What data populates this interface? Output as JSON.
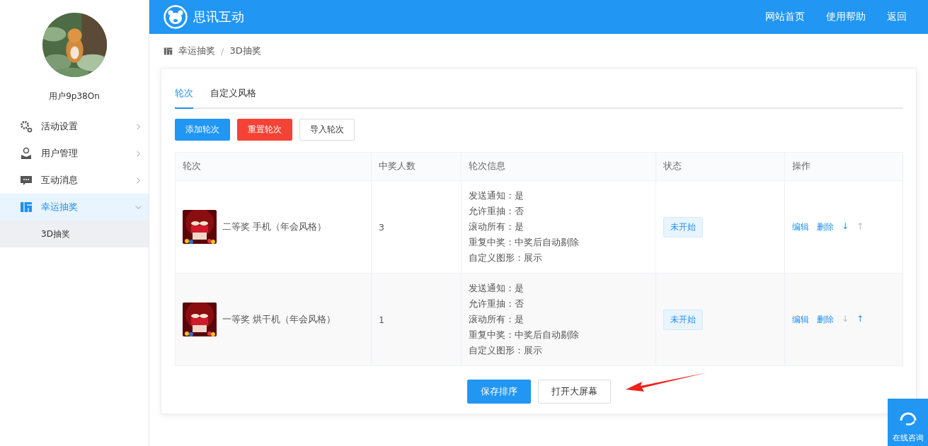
{
  "sidebar": {
    "username": "用户9p38On",
    "items": [
      {
        "label": "活动设置",
        "selected": false,
        "expanded": false
      },
      {
        "label": "用户管理",
        "selected": false,
        "expanded": false
      },
      {
        "label": "互动消息",
        "selected": false,
        "expanded": false
      },
      {
        "label": "幸运抽奖",
        "selected": true,
        "expanded": true,
        "children": [
          {
            "label": "3D抽奖",
            "selected": true
          }
        ]
      }
    ]
  },
  "header": {
    "brand": "思讯互动",
    "links": [
      "网站首页",
      "使用帮助",
      "返回"
    ]
  },
  "breadcrumb": {
    "separator": "/",
    "items": [
      "幸运抽奖",
      "3D抽奖"
    ]
  },
  "tabs": [
    {
      "label": "轮次",
      "selected": true
    },
    {
      "label": "自定义风格",
      "selected": false
    }
  ],
  "toolbar": [
    {
      "label": "添加轮次",
      "kind": "primary"
    },
    {
      "label": "重置轮次",
      "kind": "danger"
    },
    {
      "label": "导入轮次",
      "kind": "plain"
    }
  ],
  "table": {
    "columns": [
      "轮次",
      "中奖人数",
      "轮次信息",
      "状态",
      "操作"
    ],
    "rows": [
      {
        "round": "二等奖 手机（年会风格）",
        "winners": "3",
        "info": [
          "发送通知：是",
          "允许重抽：否",
          "滚动所有：是",
          "重复中奖：中奖后自动剔除",
          "自定义图形：展示"
        ],
        "status": "未开始",
        "actions": [
          "编辑",
          "删除"
        ],
        "move_down": {
          "label": "↓",
          "disabled": false
        },
        "move_up": {
          "label": "↑",
          "disabled": true
        }
      },
      {
        "round": "一等奖 烘干机（年会风格）",
        "winners": "1",
        "info": [
          "发送通知：是",
          "允许重抽：否",
          "滚动所有：是",
          "重复中奖：中奖后自动剔除",
          "自定义图形：展示"
        ],
        "status": "未开始",
        "actions": [
          "编辑",
          "删除"
        ],
        "move_down": {
          "label": "↓",
          "disabled": true
        },
        "move_up": {
          "label": "↑",
          "disabled": false
        }
      }
    ]
  },
  "footer_buttons": [
    {
      "label": "保存排序",
      "kind": "primary"
    },
    {
      "label": "打开大屏幕",
      "kind": "plain"
    }
  ],
  "consult": {
    "label": "在线咨询"
  }
}
